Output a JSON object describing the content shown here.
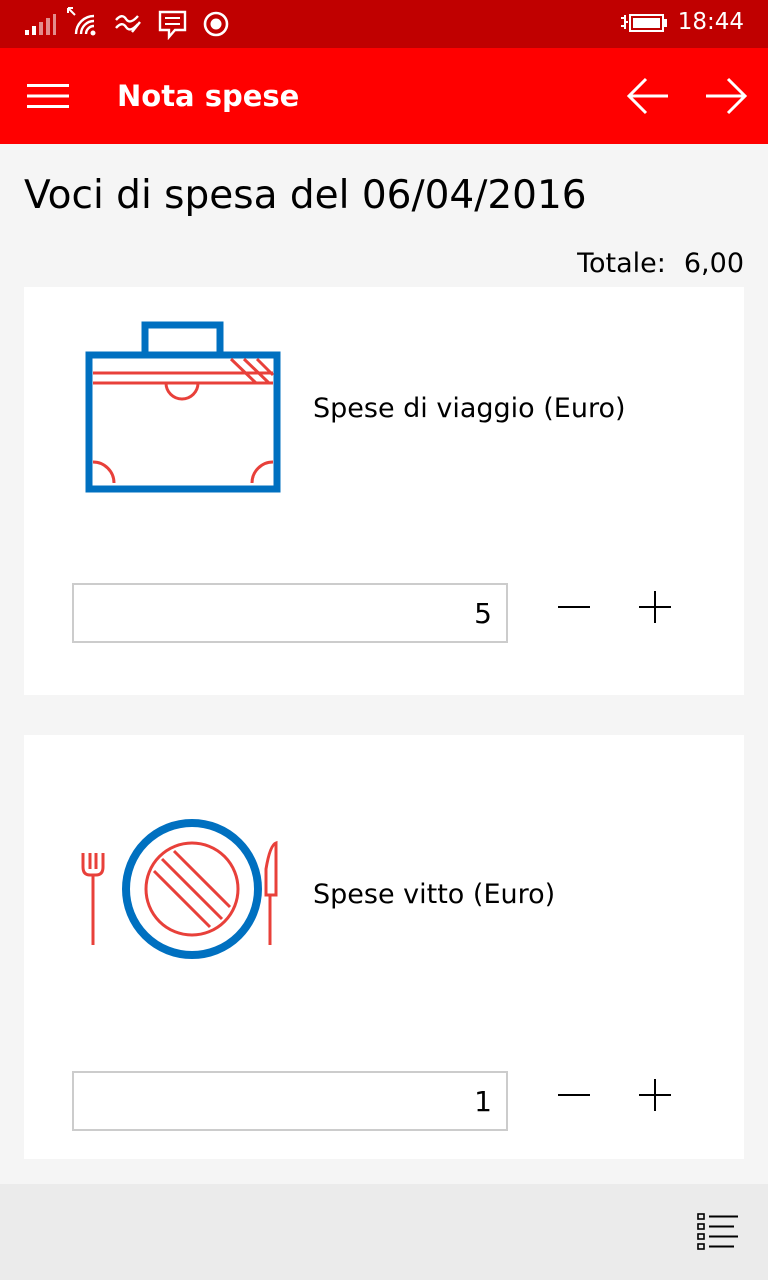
{
  "status_bar": {
    "time": "18:44",
    "icons": [
      "signal-icon",
      "wifi-icon",
      "data-icon",
      "message-icon",
      "record-icon",
      "battery-icon"
    ]
  },
  "app_bar": {
    "title": "Nota spese",
    "menu_icon": "hamburger-icon",
    "back_icon": "arrow-left-icon",
    "forward_icon": "arrow-right-icon",
    "background_color": "#ff0000",
    "status_bar_color": "#c00000"
  },
  "page": {
    "heading": "Voci di spesa del 06/04/2016",
    "total_label": "Totale:",
    "total_value": "6,00"
  },
  "items": [
    {
      "label": "Spese di viaggio (Euro)",
      "value": "5",
      "icon": "suitcase-icon",
      "minus_icon": "minus-icon",
      "plus_icon": "plus-icon"
    },
    {
      "label": "Spese vitto (Euro)",
      "value": "1",
      "icon": "plate-cutlery-icon",
      "minus_icon": "minus-icon",
      "plus_icon": "plus-icon"
    }
  ],
  "bottom_bar": {
    "list_icon": "list-icon"
  },
  "colors": {
    "icon_blue": "#0070c0",
    "icon_red": "#e8403a"
  }
}
